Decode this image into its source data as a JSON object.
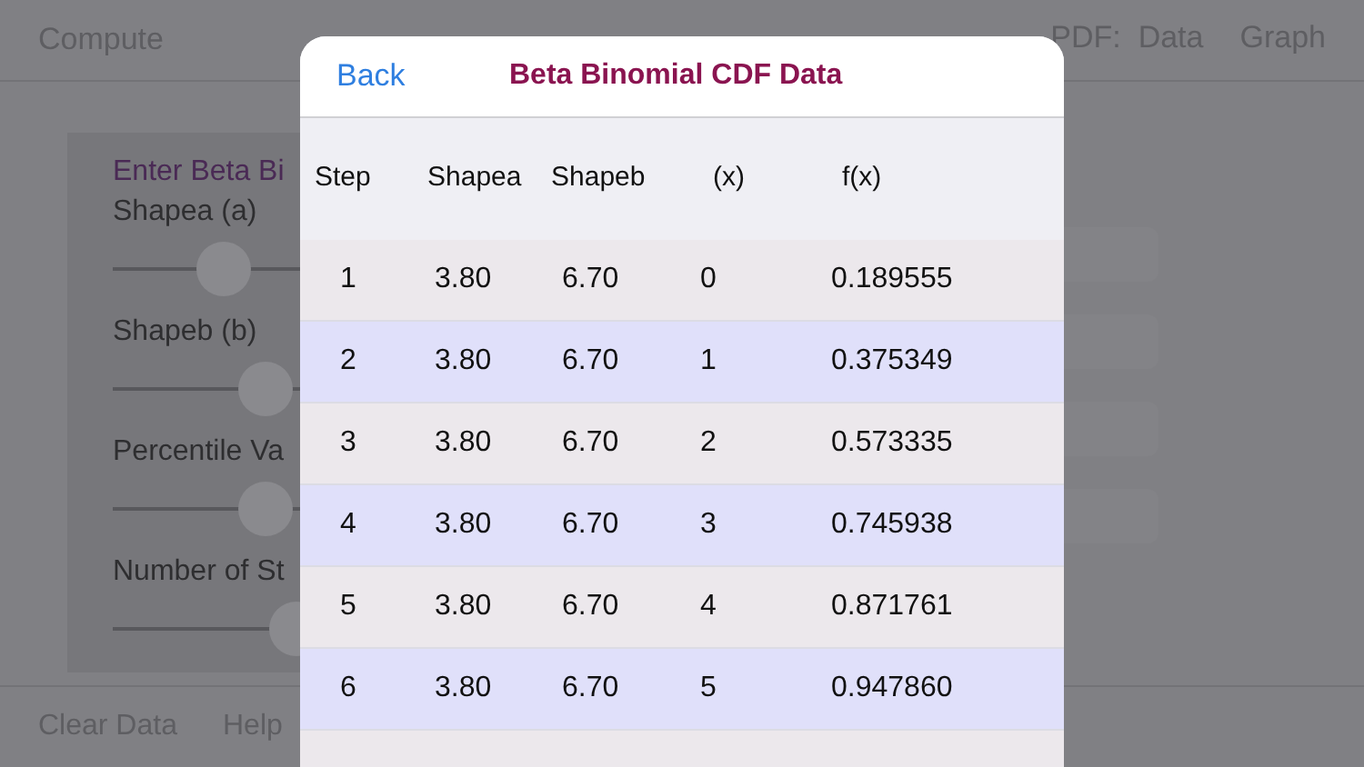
{
  "background": {
    "nav": {
      "left": "Compute",
      "right": [
        "PDF:  Data",
        "Graph"
      ]
    },
    "panel": {
      "heading": "Enter Beta Bi",
      "sliders": [
        {
          "label": "Shapea (a)",
          "level": 0.14
        },
        {
          "label": "Shapeb (b)",
          "level": 0.21
        },
        {
          "label": "Percentile Va",
          "level": 0.21
        },
        {
          "label": "Number of St",
          "level": 0.26
        }
      ]
    },
    "toolbar": [
      "Clear Data",
      "Help"
    ]
  },
  "modal": {
    "back": "Back",
    "title": "Beta Binomial CDF Data",
    "columns": [
      "Step",
      "Shapea",
      "Shapeb",
      "(x)",
      "f(x)"
    ],
    "rows": [
      [
        "1",
        "3.80",
        "6.70",
        "0",
        "0.189555"
      ],
      [
        "2",
        "3.80",
        "6.70",
        "1",
        "0.375349"
      ],
      [
        "3",
        "3.80",
        "6.70",
        "2",
        "0.573335"
      ],
      [
        "4",
        "3.80",
        "6.70",
        "3",
        "0.745938"
      ],
      [
        "5",
        "3.80",
        "6.70",
        "4",
        "0.871761"
      ],
      [
        "6",
        "3.80",
        "6.70",
        "5",
        "0.947860"
      ]
    ]
  }
}
